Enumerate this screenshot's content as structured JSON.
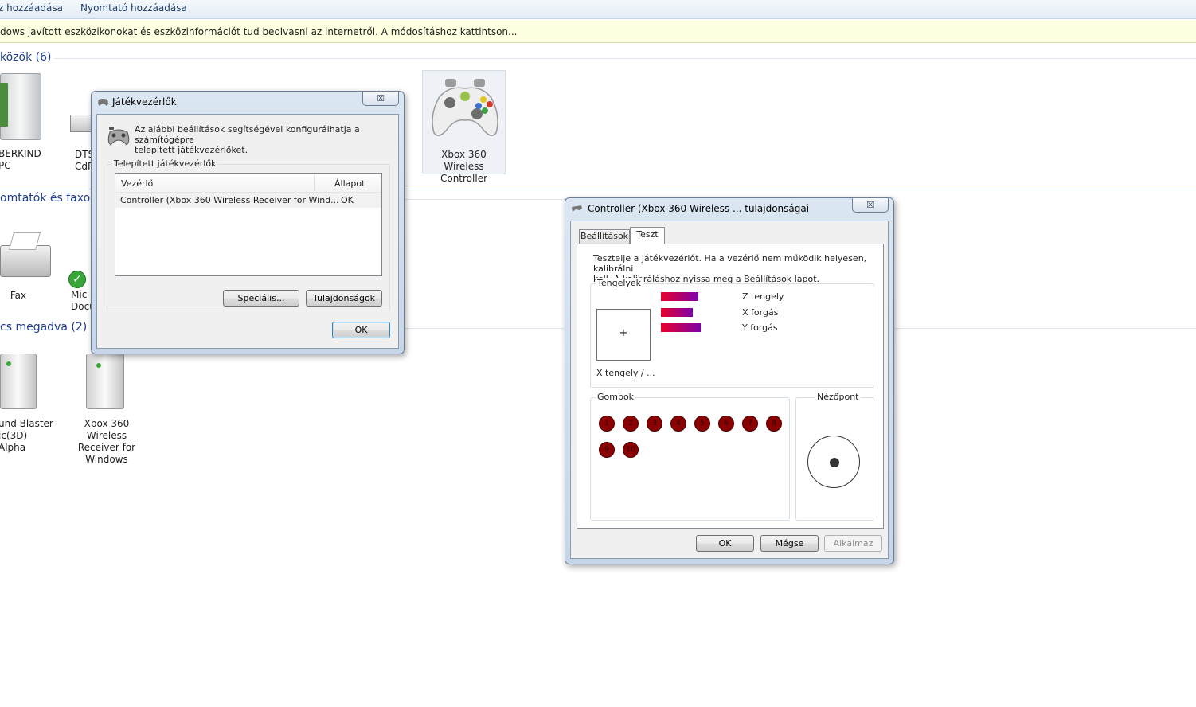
{
  "explorer": {
    "toolbar": {
      "add_device": "z hozzáadása",
      "add_printer": "Nyomtató hozzáadása"
    },
    "infobar": "dows javított eszközikonokat és eszközinformációt tud beolvasni az internetről. A módosításhoz kattintson...",
    "groups": {
      "devices": "közök (6)",
      "printers": "omtatók és faxok",
      "unspecified": "cs megadva (2)"
    },
    "devices": {
      "pc": "BERKIND-PC",
      "dts": "DTS\nCdR",
      "xbox_controller": "Xbox 360 Wireless\nController",
      "fax": "Fax",
      "mic": "Mic\nDocu",
      "sound_blaster": "und Blaster\nic(3D) Alpha",
      "xbox_receiver": "Xbox 360 Wireless\nReceiver for\nWindows"
    }
  },
  "game_controllers": {
    "title": "Játékvezérlők",
    "close": "☒",
    "description": "Az alábbi beállítások segítségével konfigurálhatja a számítógépre\ntelepített játékvezérlőket.",
    "group_label": "Telepített játékvezérlők",
    "columns": {
      "controller": "Vezérlő",
      "status": "Állapot"
    },
    "rows": [
      {
        "controller": "Controller (Xbox 360 Wireless Receiver for Wind...",
        "status": "OK"
      }
    ],
    "buttons": {
      "advanced": "Speciális...",
      "properties": "Tulajdonságok",
      "ok": "OK"
    }
  },
  "properties": {
    "title": "Controller (Xbox 360 Wireless ... tulajdonságai",
    "close": "☒",
    "tabs": {
      "settings": "Beállítások",
      "test": "Teszt"
    },
    "intro": "Tesztelje a játékvezérlőt. Ha a vezérlő nem működik helyesen, kalibrálni\nkell. A kalibráláshoz nyissa meg a Beállítások lapot.",
    "axes_label": "Tengelyek",
    "xy_label": "X tengely / ...",
    "crosshair": "+",
    "axes": [
      {
        "name": "Z tengely",
        "level": 0.52
      },
      {
        "name": "X forgás",
        "level": 0.44
      },
      {
        "name": "Y forgás",
        "level": 0.55
      }
    ],
    "buttons_label": "Gombok",
    "joy_buttons": [
      "1",
      "2",
      "3",
      "4",
      "5",
      "6",
      "7",
      "8",
      "9",
      "10"
    ],
    "pov_label": "Nézőpont",
    "footer": {
      "ok": "OK",
      "cancel": "Mégse",
      "apply": "Alkalmaz"
    }
  }
}
